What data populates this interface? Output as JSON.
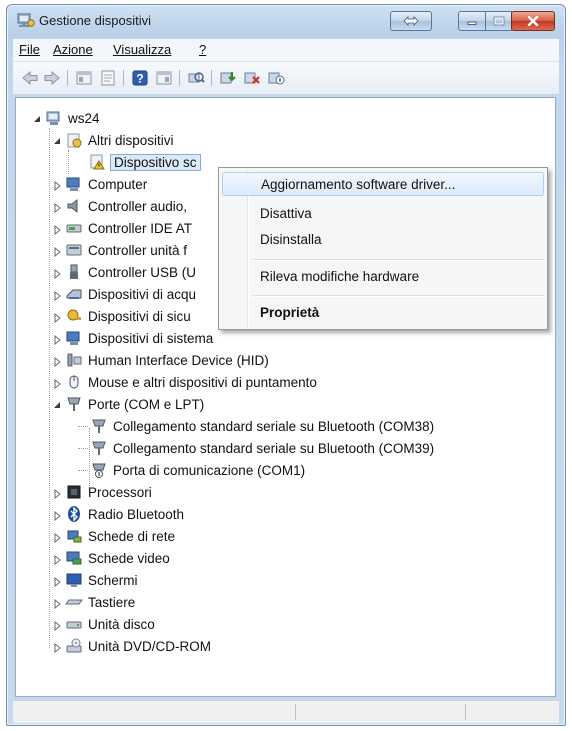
{
  "window": {
    "title": "Gestione dispositivi",
    "controls": [
      "dual-monitor-icon",
      "minimize-icon",
      "maximize-icon",
      "close-icon"
    ]
  },
  "menu": {
    "file": "File",
    "azione": "Azione",
    "visualizza": "Visualizza",
    "help": "?"
  },
  "toolbar": {
    "icons": [
      "back-arrow-icon",
      "forward-arrow-icon",
      "show-hide-tree-icon",
      "properties-icon",
      "help-icon",
      "show-hide-console-icon",
      "scan-hardware-icon",
      "update-driver-icon",
      "uninstall-device-icon",
      "disable-device-icon"
    ]
  },
  "tree": {
    "root": "ws24",
    "altri": "Altri dispositivi",
    "altri_child": "Dispositivo sconosciuto",
    "altri_child_visible": "Dispositivo sc",
    "computer": "Computer",
    "controller_audio": "Controller audio,",
    "controller_ide": "Controller IDE AT",
    "controller_unita": "Controller unità f",
    "controller_usb": "Controller USB (U",
    "acquisizione": "Dispositivi di acqu",
    "sicurezza": "Dispositivi di sicu",
    "sistema": "Dispositivi di sistema",
    "hid": "Human Interface Device (HID)",
    "mouse": "Mouse e altri dispositivi di puntamento",
    "porte": "Porte (COM e LPT)",
    "com38": "Collegamento standard seriale su Bluetooth (COM38)",
    "com39": "Collegamento standard seriale su Bluetooth (COM39)",
    "com1": "Porta di comunicazione (COM1)",
    "processori": "Processori",
    "bluetooth": "Radio Bluetooth",
    "rete": "Schede di rete",
    "video": "Schede video",
    "schermi": "Schermi",
    "tastiere": "Tastiere",
    "disco": "Unità disco",
    "dvd": "Unità DVD/CD-ROM"
  },
  "context_menu": {
    "update_driver": "Aggiornamento software driver...",
    "disable": "Disattiva",
    "uninstall": "Disinstalla",
    "scan": "Rileva modifiche hardware",
    "properties": "Proprietà"
  },
  "colors": {
    "selection": "#dbe9f8",
    "menu_highlight": "#dcebfc",
    "title_gradient": "#b9d0e8",
    "close_button": "#c13a22"
  }
}
